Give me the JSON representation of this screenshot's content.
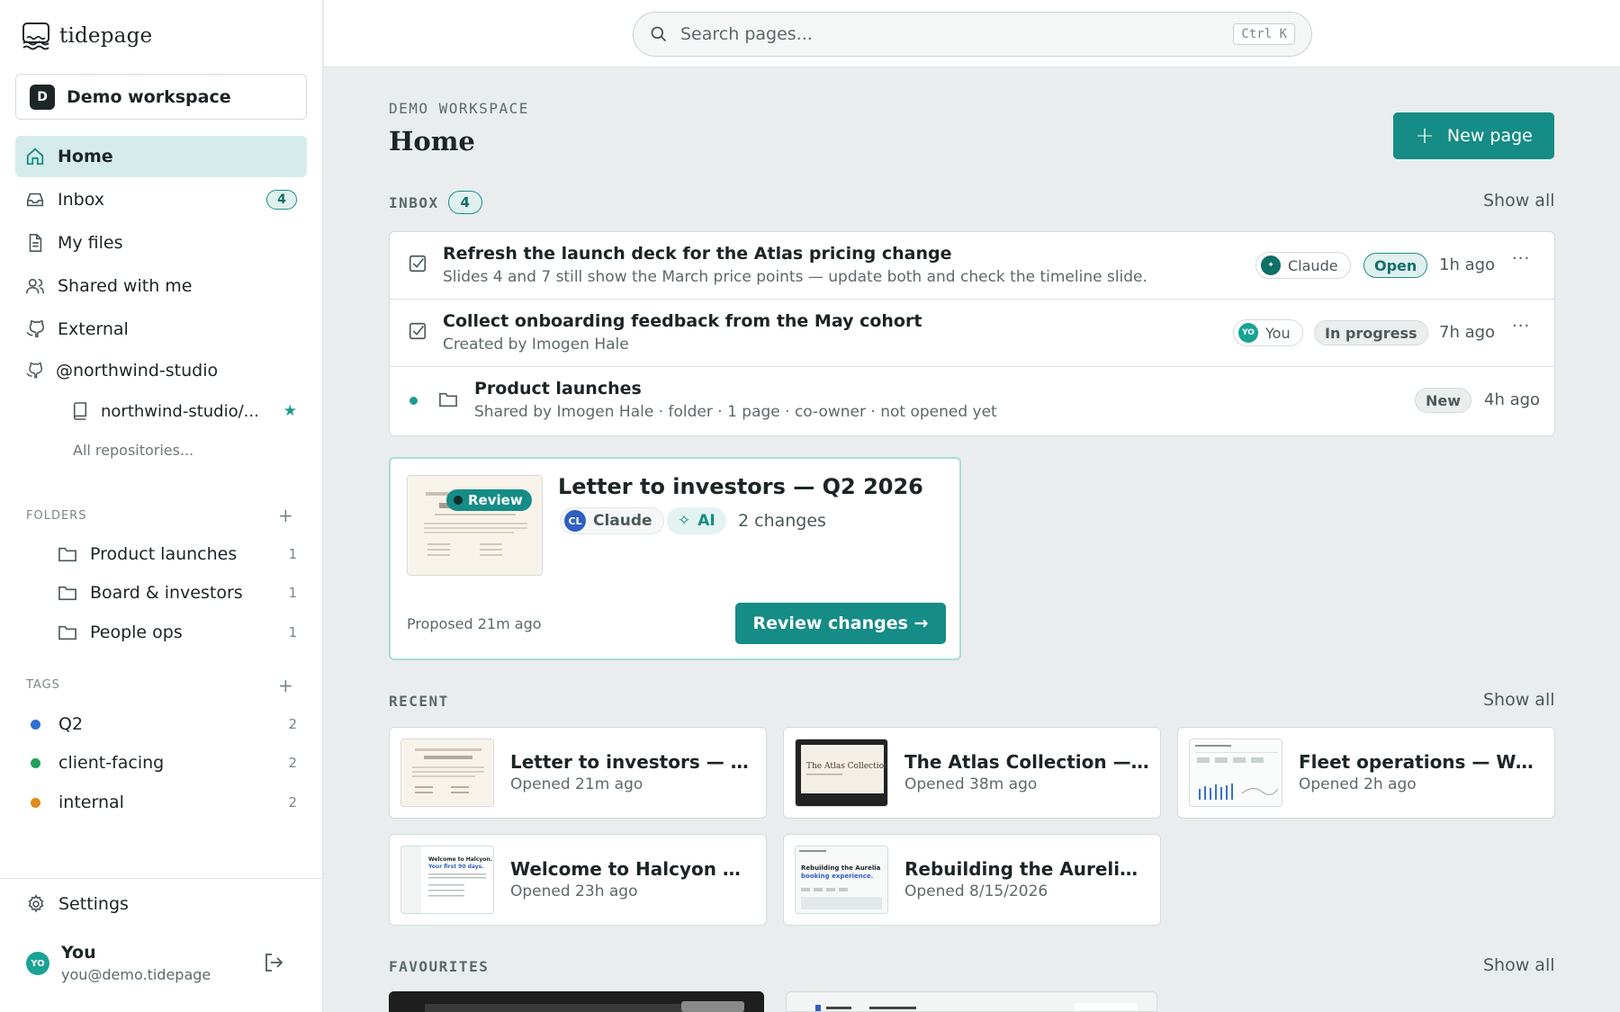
{
  "app": {
    "name": "tidepage"
  },
  "workspace": {
    "initial": "D",
    "name": "Demo workspace"
  },
  "nav": [
    {
      "label": "Home",
      "active": true
    },
    {
      "label": "Inbox",
      "badge": "4"
    },
    {
      "label": "My files"
    },
    {
      "label": "Shared with me"
    },
    {
      "label": "External"
    },
    {
      "label": "@northwind-studio"
    }
  ],
  "repo": {
    "label": "northwind-studio/...",
    "all_label": "All repositories..."
  },
  "folders": {
    "label": "FOLDERS",
    "items": [
      {
        "name": "Product launches",
        "count": "1"
      },
      {
        "name": "Board & investors",
        "count": "1"
      },
      {
        "name": "People ops",
        "count": "1"
      }
    ]
  },
  "tags": {
    "label": "TAGS",
    "items": [
      {
        "name": "Q2",
        "count": "2",
        "color": "#2f6fd0"
      },
      {
        "name": "client-facing",
        "count": "2",
        "color": "#22a05a"
      },
      {
        "name": "internal",
        "count": "2",
        "color": "#e08a1a"
      }
    ]
  },
  "footer": {
    "settings": "Settings",
    "user_initials": "YO",
    "user_name": "You",
    "user_email": "you@demo.tidepage"
  },
  "search": {
    "placeholder": "Search pages...",
    "shortcut": "Ctrl K"
  },
  "header": {
    "eyebrow": "DEMO WORKSPACE",
    "title": "Home",
    "new_page": "New page"
  },
  "inbox": {
    "label": "INBOX",
    "count": "4",
    "show_all": "Show all",
    "rows": [
      {
        "title": "Refresh the launch deck for the Atlas pricing change",
        "subtitle": "Slides 4 and 7 still show the March price points — update both and check the timeline slide.",
        "assignee": "Claude",
        "status": "Open",
        "time": "1h ago",
        "more": "···"
      },
      {
        "title": "Collect onboarding feedback from the May cohort",
        "subtitle": "Created by Imogen Hale",
        "assignee_initials": "YO",
        "assignee": "You",
        "status": "In progress",
        "time": "7h ago",
        "more": "···"
      },
      {
        "title": "Product launches",
        "subtitle": "Shared by Imogen Hale · folder · 1 page · co-owner · not opened yet",
        "status": "New",
        "time": "4h ago"
      }
    ]
  },
  "review": {
    "pill": "Review",
    "title": "Letter to investors — Q2 2026",
    "author_initials": "CL",
    "author": "Claude",
    "ai_label": "AI",
    "changes": "2 changes",
    "proposed": "Proposed 21m ago",
    "button": "Review changes →"
  },
  "recent": {
    "label": "RECENT",
    "show_all": "Show all",
    "items": [
      {
        "title": "Letter to investors — Q...",
        "opened": "Opened 21m ago"
      },
      {
        "title": "The Atlas Collection — I...",
        "opened": "Opened 38m ago"
      },
      {
        "title": "Fleet operations — Wee...",
        "opened": "Opened 2h ago"
      },
      {
        "title": "Welcome to Halcyon — ...",
        "opened": "Opened 23h ago"
      },
      {
        "title": "Rebuilding the Aurelia ...",
        "opened": "Opened 8/15/2026"
      }
    ]
  },
  "favourites": {
    "label": "FAVOURITES",
    "show_all": "Show all"
  },
  "colors": {
    "accent": "#158c85",
    "accent_light": "#dff0ee",
    "background": "#e9eded"
  }
}
